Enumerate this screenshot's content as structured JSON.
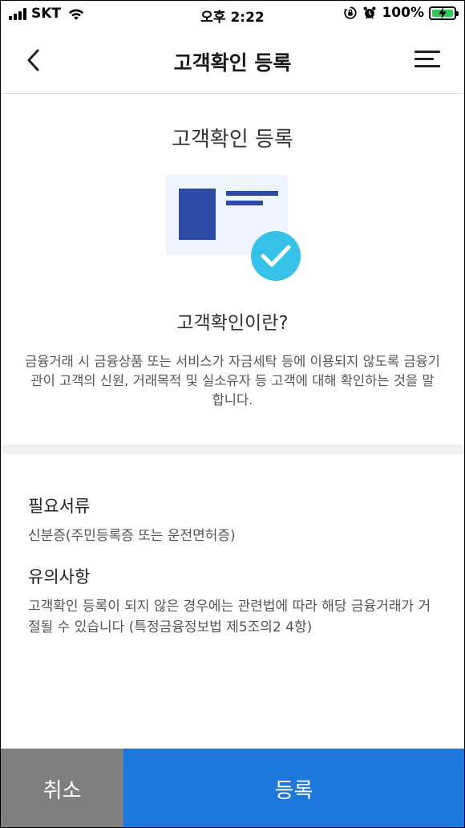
{
  "status_bar": {
    "carrier": "SKT",
    "time": "오후 2:22",
    "battery_percent": "100%",
    "icons": [
      "signal-icon",
      "wifi-icon",
      "rotation-lock-icon",
      "alarm-icon",
      "battery-charging-icon"
    ]
  },
  "header": {
    "title": "고객확인 등록",
    "back_icon": "chevron-left-icon",
    "menu_icon": "hamburger-menu-icon"
  },
  "content": {
    "title": "고객확인 등록",
    "illustration_icon": "id-card-check-icon",
    "question": "고객확인이란?",
    "description": "금융거래 시 금융상품 또는 서비스가 자금세탁 등에 이용되지 않도록 금융기관이 고객의 신원, 거래목적 및 실소유자 등 고객에 대해 확인하는 것을 말합니다."
  },
  "required_docs": {
    "heading": "필요서류",
    "body": "신분증(주민등록증 또는 운전면허증)"
  },
  "notes": {
    "heading": "유의사항",
    "body": "고객확인 등록이 되지 않은 경우에는 관련법에 따라 해당 금융거래가 거절될 수 있습니다 (특정금융정보법 제5조의2 4항)"
  },
  "buttons": {
    "cancel": "취소",
    "register": "등록"
  },
  "colors": {
    "primary": "#1e78dc",
    "cancel_bg": "#7f7f7f",
    "check_badge": "#36c1e8",
    "card_dark": "#2c4aa6",
    "card_bg": "#eef5fc",
    "battery": "#34c759"
  }
}
